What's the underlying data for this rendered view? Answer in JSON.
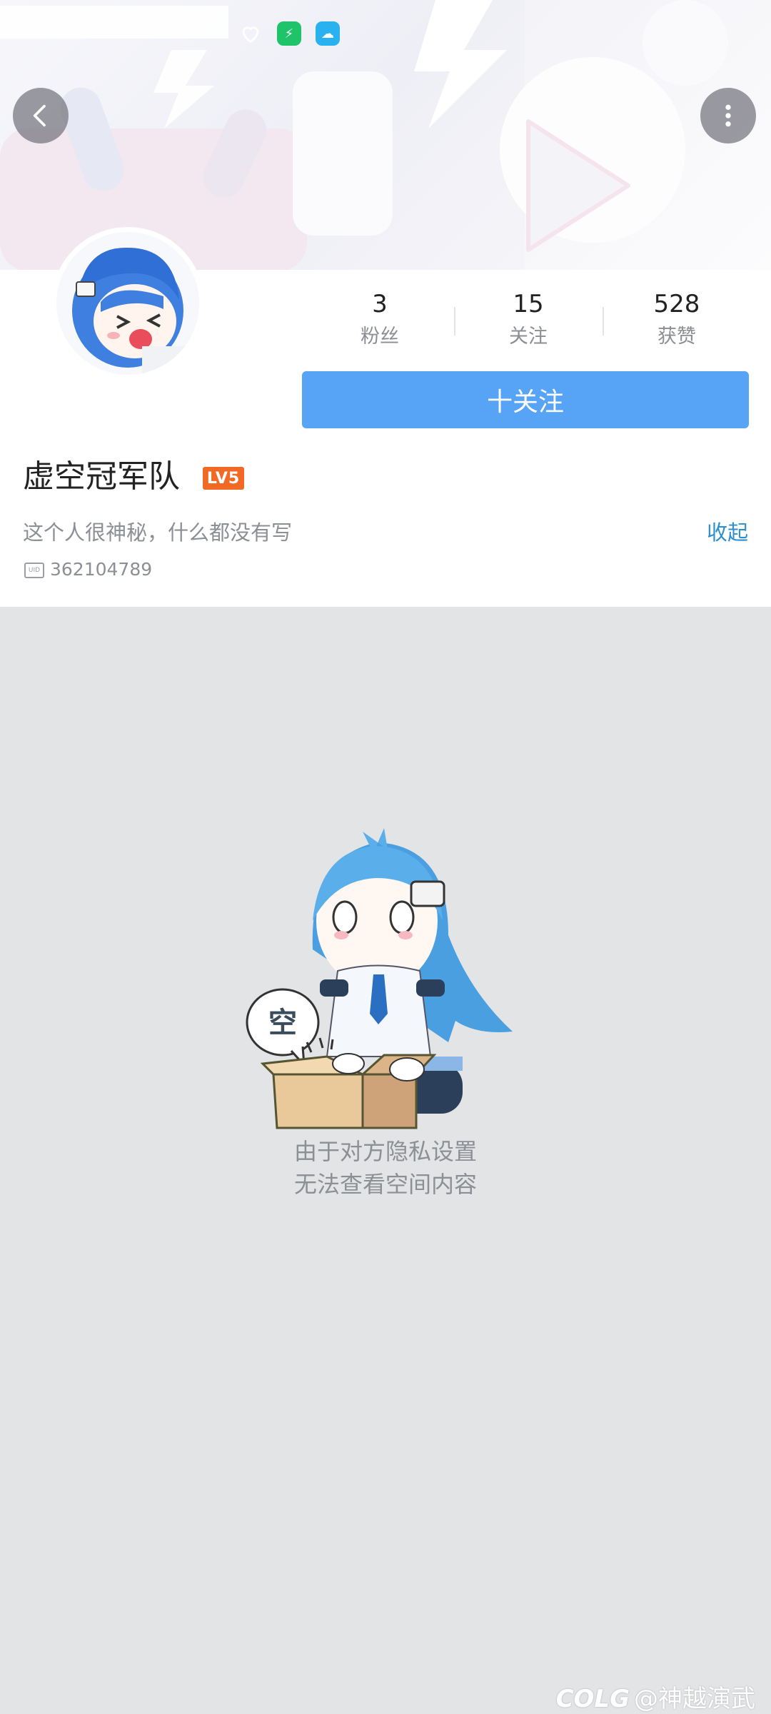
{
  "profile": {
    "name": "虚空冠军队",
    "level": "LV5",
    "bio": "这个人很神秘，什么都没有写",
    "collapse_label": "收起",
    "uid_label": "UID",
    "uid": "362104789",
    "follow_label": "十关注"
  },
  "stats": [
    {
      "value": "3",
      "label": "粉丝"
    },
    {
      "value": "15",
      "label": "关注"
    },
    {
      "value": "528",
      "label": "获赞"
    }
  ],
  "empty_state": {
    "bubble_text": "空",
    "line1": "由于对方隐私设置",
    "line2": "无法查看空间内容"
  },
  "watermark": {
    "logo": "COLG",
    "text": "@神越演武"
  },
  "colors": {
    "follow_button": "#57a3f5",
    "level_badge": "#f06a26",
    "collapse_link": "#2a8fd0",
    "content_bg": "#e3e4e6"
  },
  "icons": {
    "back": "chevron-left-icon",
    "more": "more-vertical-icon",
    "status_1": "heart-outline-icon",
    "status_2": "green-app-icon",
    "status_3": "cloud-app-icon"
  }
}
